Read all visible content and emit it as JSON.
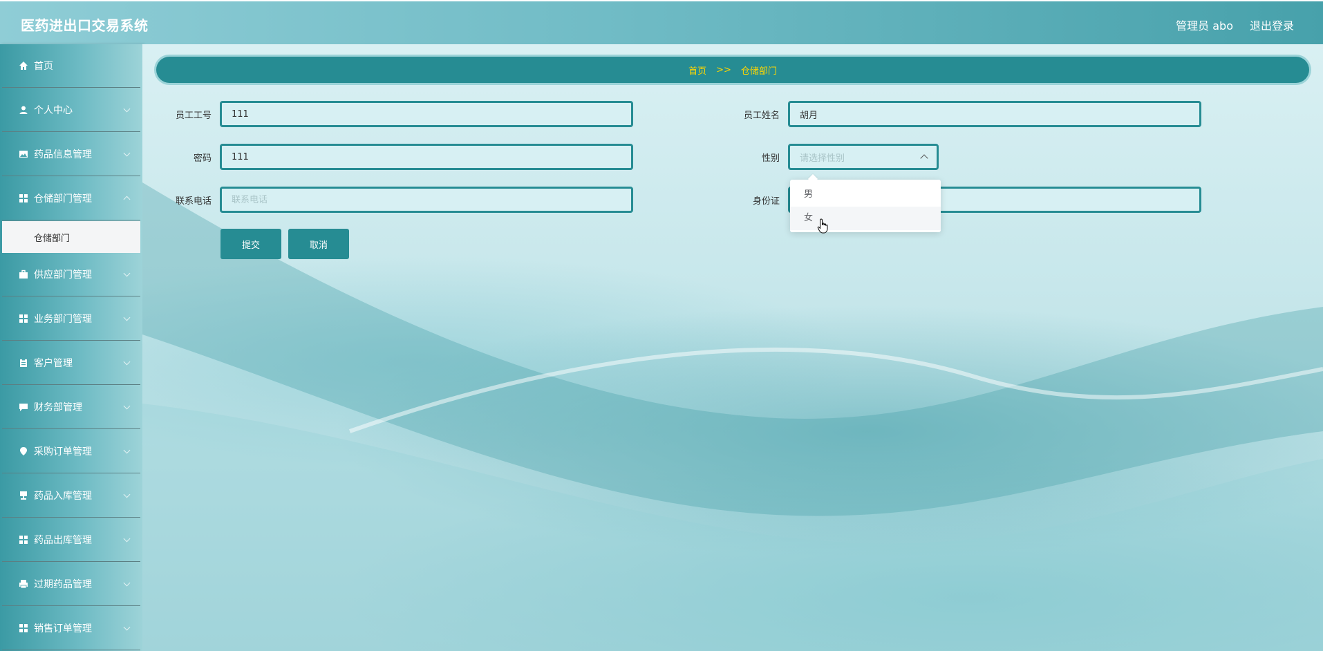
{
  "header": {
    "title": "医药进出口交易系统",
    "user": "管理员 abo",
    "logout": "退出登录"
  },
  "sidebar": {
    "items": [
      {
        "label": "首页",
        "icon": "home-icon"
      },
      {
        "label": "个人中心",
        "icon": "user-icon"
      },
      {
        "label": "药品信息管理",
        "icon": "image-icon"
      },
      {
        "label": "仓储部门管理",
        "icon": "grid-icon"
      },
      {
        "label": "供应部门管理",
        "icon": "briefcase-icon"
      },
      {
        "label": "业务部门管理",
        "icon": "grid-icon"
      },
      {
        "label": "客户管理",
        "icon": "clipboard-icon"
      },
      {
        "label": "财务部管理",
        "icon": "chat-icon"
      },
      {
        "label": "采购订单管理",
        "icon": "location-icon"
      },
      {
        "label": "药品入库管理",
        "icon": "stamp-icon"
      },
      {
        "label": "药品出库管理",
        "icon": "grid-icon"
      },
      {
        "label": "过期药品管理",
        "icon": "printer-icon"
      },
      {
        "label": "销售订单管理",
        "icon": "grid-icon"
      }
    ],
    "active_sub": "仓储部门"
  },
  "breadcrumb": {
    "home": "首页",
    "sep": ">>",
    "current": "仓储部门"
  },
  "form": {
    "emp_no": {
      "label": "员工工号",
      "value": "111"
    },
    "emp_name": {
      "label": "员工姓名",
      "value": "胡月"
    },
    "password": {
      "label": "密码",
      "value": "111"
    },
    "gender": {
      "label": "性别",
      "placeholder": "请选择性别",
      "options": [
        "男",
        "女"
      ]
    },
    "phone": {
      "label": "联系电话",
      "placeholder": "联系电话",
      "value": ""
    },
    "id_card": {
      "label": "身份证",
      "value": ""
    },
    "submit": "提交",
    "cancel": "取消"
  },
  "colors": {
    "accent": "#268c93",
    "breadcrumb_text": "#ffd700"
  }
}
